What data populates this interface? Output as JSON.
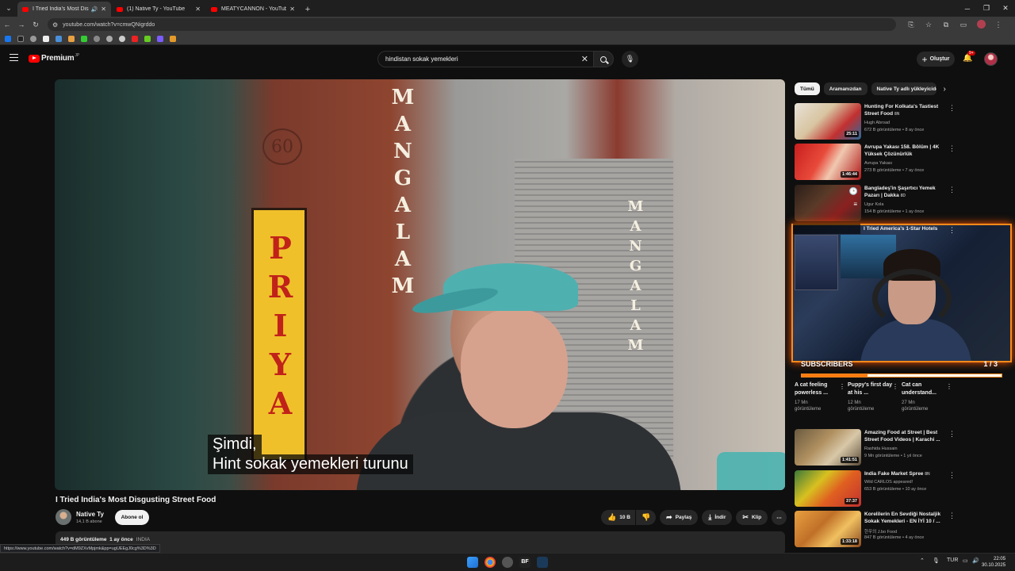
{
  "browser": {
    "tabs": [
      {
        "title": "I Tried India's Most Disgusti",
        "active": true,
        "audio": true
      },
      {
        "title": "(1) Native Ty - YouTube",
        "active": false
      },
      {
        "title": "MEATYCANNON - YouTube",
        "active": false
      }
    ],
    "url": "youtube.com/watch?v=cmwQNigrddo",
    "status_url": "https://www.youtube.com/watch?v=dM9ZXvMpjmk&pp=ugUEEgJ0cg%3D%3D"
  },
  "youtube": {
    "logo_text": "Premium",
    "logo_region": "JP",
    "search_value": "hindistan sokak yemekleri",
    "create_label": "Oluştur",
    "notification_count": "9+"
  },
  "video": {
    "subtitle_line1": "Şimdi,",
    "subtitle_line2": "Hint sokak yemekleri turunu",
    "sign_text_left": "PRIYA",
    "sign_text_center": "MANGALAM",
    "sign_text_right": "MANGALAM",
    "sign_number": "60",
    "title": "I Tried India's Most Disgusting Street Food",
    "channel": "Native Ty",
    "subscribers": "14,1 B abone",
    "subscribe_label": "Abone ol",
    "likes": "10 B",
    "share_label": "Paylaş",
    "download_label": "İndir",
    "clip_label": "Klip",
    "views": "449 B görüntüleme",
    "posted": "1 ay önce",
    "tag": "INDIA"
  },
  "sidebar": {
    "chips": [
      "Tümü",
      "Aramanızdan",
      "Native Ty adlı yükleyiciden"
    ],
    "recommendations_top": [
      {
        "title": "Hunting For Kolkata's Tastiest Street Food",
        "badge": "8N",
        "channel": "Hugh Abroad",
        "meta": "672 B görüntüleme • 8 ay önce",
        "duration": "25:11"
      },
      {
        "title": "Avrupa Yakası 158. Bölüm | 4K Yüksek Çözünürlük",
        "badge": "",
        "channel": "Avrupa Yakası",
        "meta": "273 B görüntüleme • 7 ay önce",
        "duration": "1:46:44"
      },
      {
        "title": "Bangladeş'in Şaşırtıcı Yemek Pazarı | Dakka",
        "badge": "8D",
        "channel": "Ugur Kola",
        "meta": "154 B görüntüleme • 1 ay önce",
        "duration": ""
      }
    ],
    "partial_title": "I Tried America's 1-Star Hotels",
    "shorts": [
      {
        "title": "A cat feeling powerless ...",
        "views": "17 Mn",
        "views_label": "görüntüleme"
      },
      {
        "title": "Puppy's first day at his ...",
        "views": "12 Mn",
        "views_label": "görüntüleme"
      },
      {
        "title": "Cat can understand...",
        "views": "27 Mn",
        "views_label": "görüntüleme"
      }
    ],
    "recommendations_bottom": [
      {
        "title": "Amazing Food at Street | Best Street Food Videos | Karachi ...",
        "badge": "",
        "channel": "Rashida Hussain",
        "meta": "9 Mn görüntüleme • 1 yıl önce",
        "duration": "1:41:51"
      },
      {
        "title": "India Fake Market Spree",
        "badge": "8N",
        "channel": "Wild CARLOS appeared!",
        "meta": "653 B görüntüleme • 10 ay önce",
        "duration": "37:37"
      },
      {
        "title": "Korelilerin En Sevdiği Nostaljik Sokak Yemekleri - EN İYİ 10 / ...",
        "badge": "",
        "channel": "한우의 J.bo Food",
        "meta": "847 B görüntüleme • 4 ay önce",
        "duration": "1:33:18"
      }
    ]
  },
  "overlay": {
    "label": "SUBSCRIBERS",
    "count": "1 / 3",
    "progress": 0.33
  },
  "taskbar": {
    "lang": "TUR",
    "time": "22:05",
    "date": "30.10.2025"
  },
  "colors": {
    "yt_red": "#ff0000",
    "overlay_orange": "#ff8a1a"
  }
}
